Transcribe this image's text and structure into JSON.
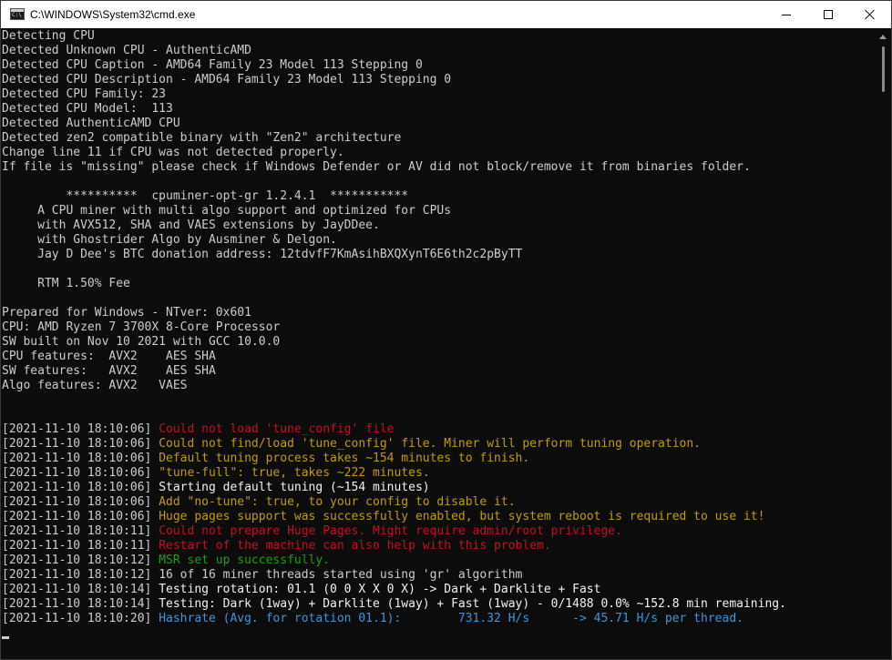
{
  "window": {
    "title": "C:\\WINDOWS\\System32\\cmd.exe",
    "icon": "cmd-icon",
    "controls": {
      "minimize": "minimize-icon",
      "maximize": "maximize-icon",
      "close": "close-icon"
    }
  },
  "colors": {
    "background": "#0c0c0c",
    "default_text": "#cccccc",
    "red": "#c50f1f",
    "yellow": "#c19c00",
    "green": "#13a10e",
    "white": "#f2f2f2",
    "cyan": "#3a96dd"
  },
  "console": {
    "lines": [
      "Detecting CPU",
      "Detected Unknown CPU - AuthenticAMD",
      "Detected CPU Caption - AMD64 Family 23 Model 113 Stepping 0",
      "Detected CPU Description - AMD64 Family 23 Model 113 Stepping 0",
      "Detected CPU Family: 23",
      "Detected CPU Model:  113",
      "Detected AuthenticAMD CPU",
      "Detected zen2 compatible binary with \"Zen2\" architecture",
      "Change line 11 if CPU was not detected properly.",
      "If file is \"missing\" please check if Windows Defender or AV did not block/remove it from binaries folder.",
      "",
      "         **********  cpuminer-opt-gr 1.2.4.1  ***********",
      "     A CPU miner with multi algo support and optimized for CPUs",
      "     with AVX512, SHA and VAES extensions by JayDDee.",
      "     with Ghostrider Algo by Ausminer & Delgon.",
      "     Jay D Dee's BTC donation address: 12tdvfF7KmAsihBXQXynT6E6th2c2pByTT",
      "",
      "     RTM 1.50% Fee",
      "",
      "Prepared for Windows - NTver: 0x601",
      "CPU: AMD Ryzen 7 3700X 8-Core Processor",
      "SW built on Nov 10 2021 with GCC 10.0.0",
      "CPU features:  AVX2    AES SHA",
      "SW features:   AVX2    AES SHA",
      "Algo features: AVX2   VAES",
      "",
      ""
    ],
    "log": [
      {
        "time": "[2021-11-10 18:10:06] ",
        "msg": "Could not load 'tune_config' file",
        "color": "red"
      },
      {
        "time": "[2021-11-10 18:10:06] ",
        "msg": "Could not find/load 'tune_config' file. Miner will perform tuning operation.",
        "color": "yellow"
      },
      {
        "time": "[2021-11-10 18:10:06] ",
        "msg": "Default tuning process takes ~154 minutes to finish.",
        "color": "yellow"
      },
      {
        "time": "[2021-11-10 18:10:06] ",
        "msg": "\"tune-full\": true, takes ~222 minutes.",
        "color": "yellow"
      },
      {
        "time": "[2021-11-10 18:10:06] ",
        "msg": "Starting default tuning (~154 minutes)",
        "color": "white"
      },
      {
        "time": "[2021-11-10 18:10:06] ",
        "msg": "Add \"no-tune\": true, to your config to disable it.",
        "color": "yellow"
      },
      {
        "time": "[2021-11-10 18:10:06] ",
        "msg": "Huge pages support was successfully enabled, but system reboot is required to use it!",
        "color": "yellow"
      },
      {
        "time": "[2021-11-10 18:10:11] ",
        "msg": "Could not prepare Huge Pages. Might require admin/root privilege.",
        "color": "red"
      },
      {
        "time": "[2021-11-10 18:10:11] ",
        "msg": "Restart of the machine can also help with this problem.",
        "color": "red"
      },
      {
        "time": "[2021-11-10 18:10:12] ",
        "msg": "MSR set up successfully.",
        "color": "green"
      },
      {
        "time": "[2021-11-10 18:10:12] ",
        "msg": "16 of 16 miner threads started using 'gr' algorithm",
        "color": "default"
      },
      {
        "time": "[2021-11-10 18:10:14] ",
        "msg": "Testing rotation: 01.1 (0 0 X X 0 X) -> Dark + Darklite + Fast",
        "color": "white"
      },
      {
        "time": "[2021-11-10 18:10:14] ",
        "msg": "Testing: Dark (1way) + Darklite (1way) + Fast (1way) - 0/1488 0.0% ~152.8 min remaining.",
        "color": "white"
      },
      {
        "time": "[2021-11-10 18:10:20] ",
        "msg": "Hashrate (Avg. for rotation 01.1):        731.32 H/s      -> 45.71 H/s per thread.",
        "color": "cyan"
      }
    ]
  }
}
